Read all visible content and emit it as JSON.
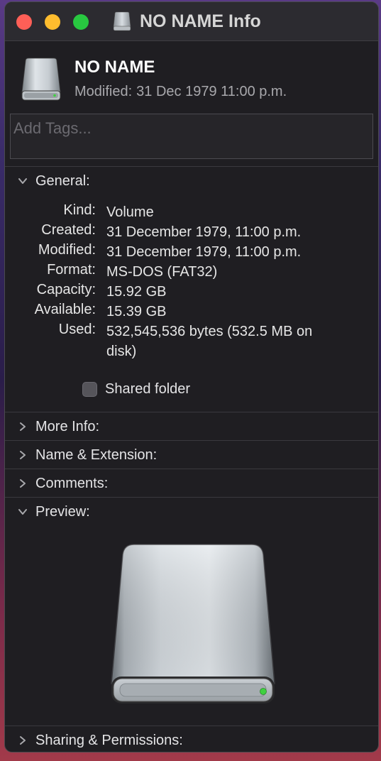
{
  "window": {
    "title": "NO NAME Info"
  },
  "header": {
    "name": "NO NAME",
    "modified_label": "Modified:",
    "modified_value": "31 Dec 1979 11:00 p.m."
  },
  "tags": {
    "placeholder": "Add Tags..."
  },
  "sections": {
    "general": "General:",
    "more_info": "More Info:",
    "name_extension": "Name & Extension:",
    "comments": "Comments:",
    "preview": "Preview:",
    "sharing": "Sharing & Permissions:"
  },
  "general": {
    "rows": [
      {
        "label": "Kind:",
        "value": "Volume"
      },
      {
        "label": "Created:",
        "value": "31 December 1979, 11:00 p.m."
      },
      {
        "label": "Modified:",
        "value": "31 December 1979, 11:00 p.m."
      },
      {
        "label": "Format:",
        "value": "MS-DOS (FAT32)"
      },
      {
        "label": "Capacity:",
        "value": "15.92 GB"
      },
      {
        "label": "Available:",
        "value": "15.39 GB"
      },
      {
        "label": "Used:",
        "value": "532,545,536 bytes (532.5 MB on disk)"
      }
    ],
    "shared_folder_label": "Shared folder",
    "shared_folder_checked": false
  },
  "colors": {
    "close": "#fe5f57",
    "minimize": "#febc2e",
    "maximize": "#28c840",
    "drive_led": "#3fd13f"
  },
  "icons": {
    "title_icon": "external-drive-icon",
    "header_icon": "external-drive-icon",
    "preview_icon": "external-drive-icon",
    "collapsed": "chevron-right-icon",
    "expanded": "chevron-down-icon"
  }
}
